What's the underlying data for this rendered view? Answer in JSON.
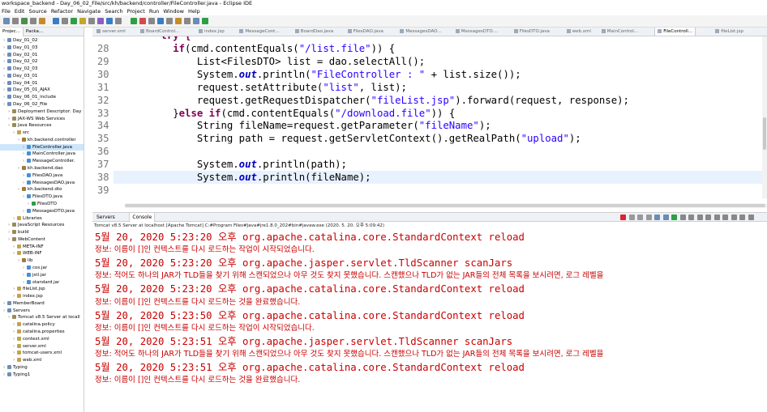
{
  "window": {
    "title": "workspace_backend - Day_06_02_File/src/kh/backend/controller/FileController.java - Eclipse IDE"
  },
  "menu": [
    "File",
    "Edit",
    "Source",
    "Refactor",
    "Navigate",
    "Search",
    "Project",
    "Run",
    "Window",
    "Help"
  ],
  "left_panel": {
    "tabs": [
      "Projec...",
      "Packa..."
    ],
    "tree": [
      {
        "label": "Day_01_02",
        "depth": 0
      },
      {
        "label": "Day_01_03",
        "depth": 0
      },
      {
        "label": "Day_02_01",
        "depth": 0
      },
      {
        "label": "Day_02_02",
        "depth": 0
      },
      {
        "label": "Day_02_03",
        "depth": 0
      },
      {
        "label": "Day_03_01",
        "depth": 0
      },
      {
        "label": "Day_04_01",
        "depth": 0
      },
      {
        "label": "Day_05_01_AJAX",
        "depth": 0
      },
      {
        "label": "Day_06_01_include",
        "depth": 0
      },
      {
        "label": "Day_06_02_File",
        "depth": 0
      },
      {
        "label": "Deployment Descriptor: Day",
        "depth": 1
      },
      {
        "label": "JAX-WS Web Services",
        "depth": 1
      },
      {
        "label": "Java Resources",
        "depth": 1
      },
      {
        "label": "src",
        "depth": 2
      },
      {
        "label": "kh.backend.controller",
        "depth": 3
      },
      {
        "label": "FileController.java",
        "depth": 4,
        "selected": true
      },
      {
        "label": "MainController.java",
        "depth": 4
      },
      {
        "label": "MessageController.",
        "depth": 4
      },
      {
        "label": "kh.backend.dao",
        "depth": 3
      },
      {
        "label": "FilesDAO.java",
        "depth": 4
      },
      {
        "label": "MessagesDAO.java",
        "depth": 4
      },
      {
        "label": "kh.backend.dto",
        "depth": 3
      },
      {
        "label": "FilesDTO.java",
        "depth": 4
      },
      {
        "label": "FilesDTO",
        "depth": 5
      },
      {
        "label": "MessagesDTO.java",
        "depth": 4
      },
      {
        "label": "Libraries",
        "depth": 2
      },
      {
        "label": "JavaScript Resources",
        "depth": 1
      },
      {
        "label": "build",
        "depth": 1
      },
      {
        "label": "WebContent",
        "depth": 1
      },
      {
        "label": "META-INF",
        "depth": 2
      },
      {
        "label": "WEB-INF",
        "depth": 2
      },
      {
        "label": "lib",
        "depth": 3
      },
      {
        "label": "cos.jar",
        "depth": 4
      },
      {
        "label": "jstl.jar",
        "depth": 4
      },
      {
        "label": "standard.jar",
        "depth": 4
      },
      {
        "label": "fileList.jsp",
        "depth": 2
      },
      {
        "label": "index.jsp",
        "depth": 2
      },
      {
        "label": "MemberBoard",
        "depth": 0
      },
      {
        "label": "Servers",
        "depth": 0
      },
      {
        "label": "Tomcat v8.5 Server at locall",
        "depth": 1
      },
      {
        "label": "catalina.policy",
        "depth": 2
      },
      {
        "label": "catalina.properties",
        "depth": 2
      },
      {
        "label": "context.xml",
        "depth": 2
      },
      {
        "label": "server.xml",
        "depth": 2
      },
      {
        "label": "tomcat-users.xml",
        "depth": 2
      },
      {
        "label": "web.xml",
        "depth": 2
      },
      {
        "label": "Typing",
        "depth": 0
      },
      {
        "label": "Typing1",
        "depth": 0
      }
    ]
  },
  "editor": {
    "tabs": [
      "server.xml",
      "BoardControl...",
      "index.jsp",
      "MessageCont...",
      "BoardDao.java",
      "FilesDAO.java",
      "MessagesDAO...",
      "MessagesDTO....",
      "FilesDTO.java",
      "web.xml",
      "MainControl...",
      "FileControll...",
      "fileList.jsp"
    ],
    "active_tab": "FileControll...",
    "top_partial": "try {",
    "lines": [
      {
        "num": "28",
        "segs": [
          {
            "t": "        "
          },
          {
            "t": "if",
            "c": "kw"
          },
          {
            "t": "(cmd.contentEquals("
          },
          {
            "t": "\"/list.file\"",
            "c": "st"
          },
          {
            "t": ")) {"
          }
        ]
      },
      {
        "num": "29",
        "segs": [
          {
            "t": "            List<FilesDTO> list = dao.selectAll();"
          }
        ]
      },
      {
        "num": "30",
        "segs": [
          {
            "t": "            System."
          },
          {
            "t": "out",
            "c": "fi"
          },
          {
            "t": ".println("
          },
          {
            "t": "\"FileController : \"",
            "c": "st"
          },
          {
            "t": " + list.size());"
          }
        ]
      },
      {
        "num": "31",
        "segs": [
          {
            "t": "            request.setAttribute("
          },
          {
            "t": "\"list\"",
            "c": "st"
          },
          {
            "t": ", list);"
          }
        ]
      },
      {
        "num": "32",
        "segs": [
          {
            "t": "            request.getRequestDispatcher("
          },
          {
            "t": "\"fileList.jsp\"",
            "c": "st"
          },
          {
            "t": ").forward(request, response);"
          }
        ]
      },
      {
        "num": "33",
        "segs": [
          {
            "t": "        }"
          },
          {
            "t": "else if",
            "c": "kw"
          },
          {
            "t": "(cmd.contentEquals("
          },
          {
            "t": "\"/download.file\"",
            "c": "st"
          },
          {
            "t": ")) {"
          }
        ]
      },
      {
        "num": "34",
        "segs": [
          {
            "t": "            String fileName=request.getParameter("
          },
          {
            "t": "\"fileName\"",
            "c": "st"
          },
          {
            "t": ");"
          }
        ]
      },
      {
        "num": "35",
        "segs": [
          {
            "t": "            String path = request.getServletContext().getRealPath("
          },
          {
            "t": "\"upload\"",
            "c": "st"
          },
          {
            "t": ");"
          }
        ]
      },
      {
        "num": "36",
        "segs": [
          {
            "t": ""
          }
        ]
      },
      {
        "num": "37",
        "segs": [
          {
            "t": "            System."
          },
          {
            "t": "out",
            "c": "fi"
          },
          {
            "t": ".println(path);"
          }
        ]
      },
      {
        "num": "38",
        "segs": [
          {
            "t": "            System."
          },
          {
            "t": "out",
            "c": "fi"
          },
          {
            "t": ".println(fileName);"
          }
        ],
        "highlight": true
      },
      {
        "num": "39",
        "segs": [
          {
            "t": ""
          }
        ]
      }
    ]
  },
  "console": {
    "tabs": [
      "Servers",
      "Console"
    ],
    "active_tab": "Console",
    "info": "Tomcat v8.5 Server at localhost [Apache Tomcat] C:#Program Files#Java#jre1.8.0_202#bin#javaw.exe (2020. 5. 20. 오후 5:09:42)",
    "lines": [
      {
        "text": "5월 20, 2020 5:23:20 오후 org.apache.catalina.core.StandardContext reload",
        "size": "big"
      },
      {
        "text": "정보: 이름이 []인 컨텍스트를 다시 로드하는 작업이 시작되었습니다.",
        "size": "small"
      },
      {
        "text": "5월 20, 2020 5:23:20 오후 org.apache.jasper.servlet.TldScanner scanJars",
        "size": "big"
      },
      {
        "text": "정보: 적어도 하나의 JAR가 TLD들을 찾기 위해 스캔되었으나 아무 것도 찾지 못했습니다. 스캔했으나 TLD가 없는 JAR들의 전체 목록을 보시려면, 로그 레벨을",
        "size": "small"
      },
      {
        "text": "5월 20, 2020 5:23:20 오후 org.apache.catalina.core.StandardContext reload",
        "size": "big"
      },
      {
        "text": "정보: 이름이 []인 컨텍스트를 다시 로드하는 것을 완료했습니다.",
        "size": "small"
      },
      {
        "text": "5월 20, 2020 5:23:50 오후 org.apache.catalina.core.StandardContext reload",
        "size": "big"
      },
      {
        "text": "정보: 이름이 []인 컨텍스트를 다시 로드하는 작업이 시작되었습니다.",
        "size": "small"
      },
      {
        "text": "5월 20, 2020 5:23:51 오후 org.apache.jasper.servlet.TldScanner scanJars",
        "size": "big"
      },
      {
        "text": "정보: 적어도 하나의 JAR가 TLD들을 찾기 위해 스캔되었으나 아무 것도 찾지 못했습니다. 스캔했으나 TLD가 없는 JAR들의 전체 목록을 보시려면, 로그 레벨을",
        "size": "small"
      },
      {
        "text": "5월 20, 2020 5:23:51 오후 org.apache.catalina.core.StandardContext reload",
        "size": "big"
      },
      {
        "text": "정보: 이름이 []인 컨텍스트를 다시 로드하는 것을 완료했습니다.",
        "size": "small"
      }
    ]
  },
  "colors": {
    "keyword": "#7f0055",
    "string": "#2a00ff",
    "field": "#0000c0",
    "console_error": "#c80000",
    "selection": "#cde6fb"
  }
}
